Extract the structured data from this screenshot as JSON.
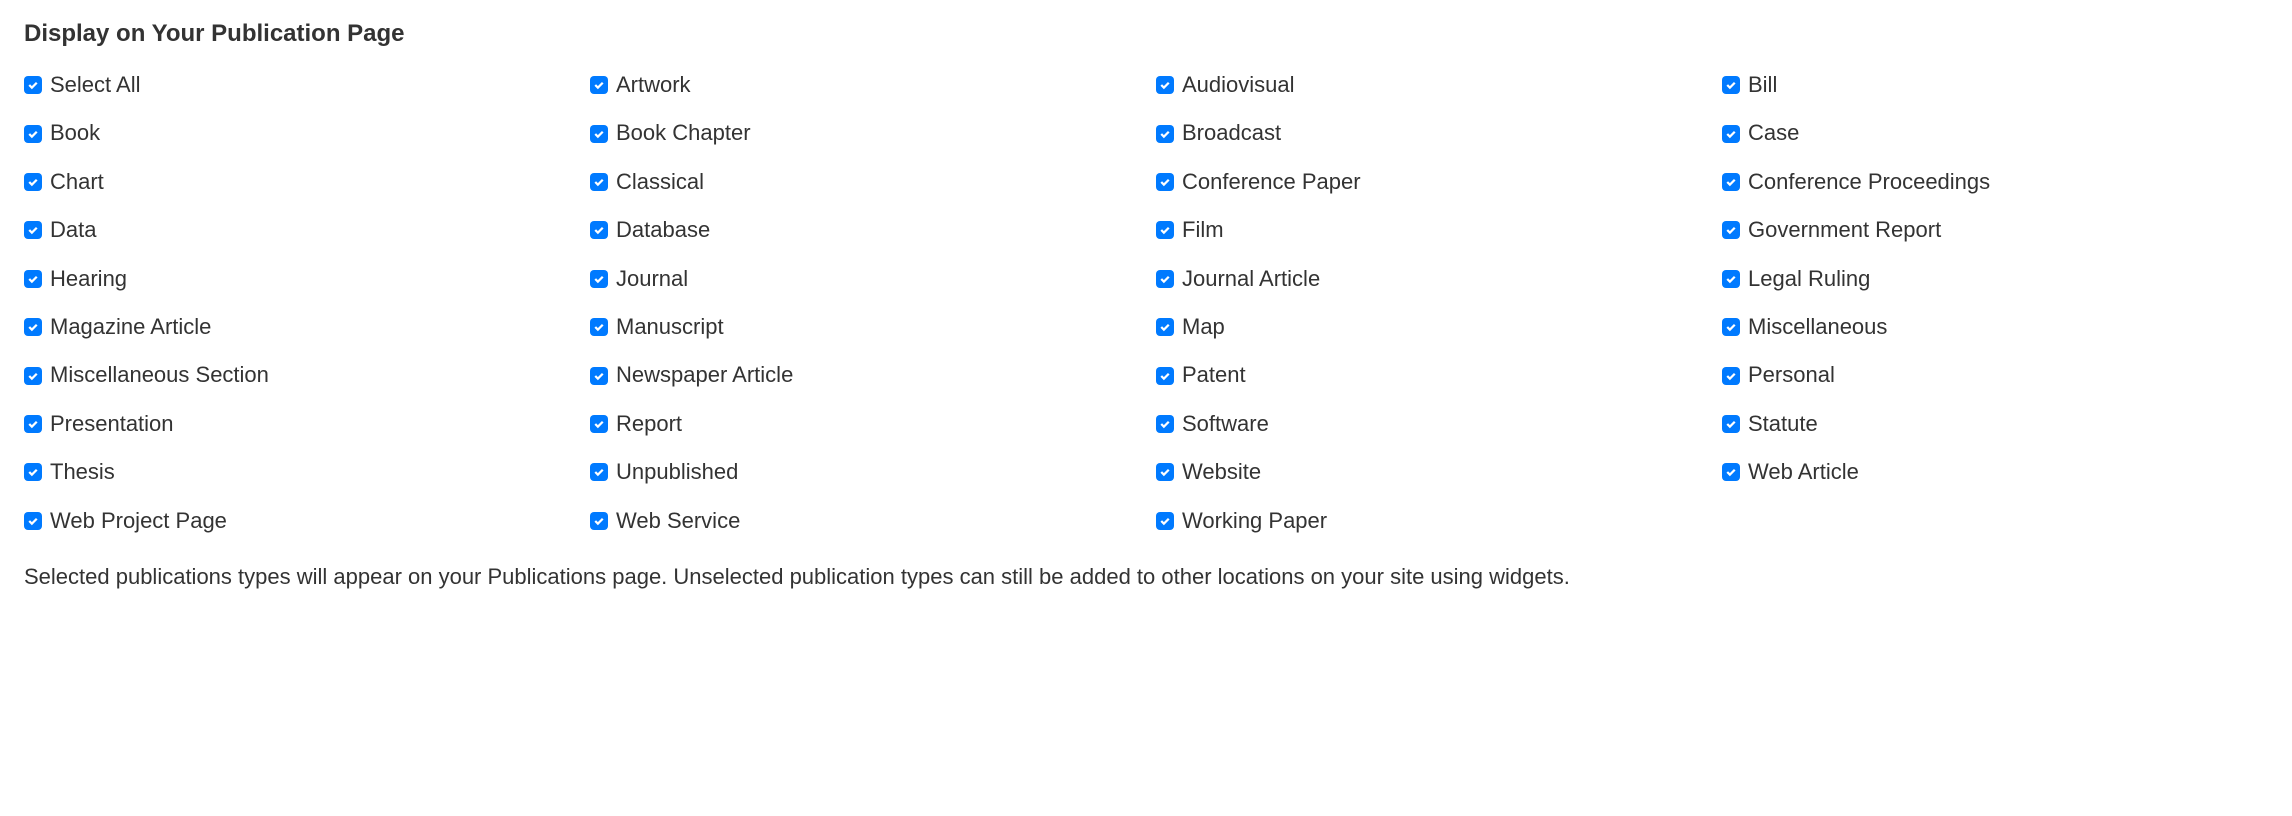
{
  "heading": "Display on Your Publication Page",
  "items": [
    {
      "label": "Select All",
      "checked": true
    },
    {
      "label": "Artwork",
      "checked": true
    },
    {
      "label": "Audiovisual",
      "checked": true
    },
    {
      "label": "Bill",
      "checked": true
    },
    {
      "label": "Book",
      "checked": true
    },
    {
      "label": "Book Chapter",
      "checked": true
    },
    {
      "label": "Broadcast",
      "checked": true
    },
    {
      "label": "Case",
      "checked": true
    },
    {
      "label": "Chart",
      "checked": true
    },
    {
      "label": "Classical",
      "checked": true
    },
    {
      "label": "Conference Paper",
      "checked": true
    },
    {
      "label": "Conference Proceedings",
      "checked": true
    },
    {
      "label": "Data",
      "checked": true
    },
    {
      "label": "Database",
      "checked": true
    },
    {
      "label": "Film",
      "checked": true
    },
    {
      "label": "Government Report",
      "checked": true
    },
    {
      "label": "Hearing",
      "checked": true
    },
    {
      "label": "Journal",
      "checked": true
    },
    {
      "label": "Journal Article",
      "checked": true
    },
    {
      "label": "Legal Ruling",
      "checked": true
    },
    {
      "label": "Magazine Article",
      "checked": true
    },
    {
      "label": "Manuscript",
      "checked": true
    },
    {
      "label": "Map",
      "checked": true
    },
    {
      "label": "Miscellaneous",
      "checked": true
    },
    {
      "label": "Miscellaneous Section",
      "checked": true
    },
    {
      "label": "Newspaper Article",
      "checked": true
    },
    {
      "label": "Patent",
      "checked": true
    },
    {
      "label": "Personal",
      "checked": true
    },
    {
      "label": "Presentation",
      "checked": true
    },
    {
      "label": "Report",
      "checked": true
    },
    {
      "label": "Software",
      "checked": true
    },
    {
      "label": "Statute",
      "checked": true
    },
    {
      "label": "Thesis",
      "checked": true
    },
    {
      "label": "Unpublished",
      "checked": true
    },
    {
      "label": "Website",
      "checked": true
    },
    {
      "label": "Web Article",
      "checked": true
    },
    {
      "label": "Web Project Page",
      "checked": true
    },
    {
      "label": "Web Service",
      "checked": true
    },
    {
      "label": "Working Paper",
      "checked": true
    }
  ],
  "footer": "Selected publications types will appear on your Publications page. Unselected publication types can still be added to other locations on your site using widgets."
}
